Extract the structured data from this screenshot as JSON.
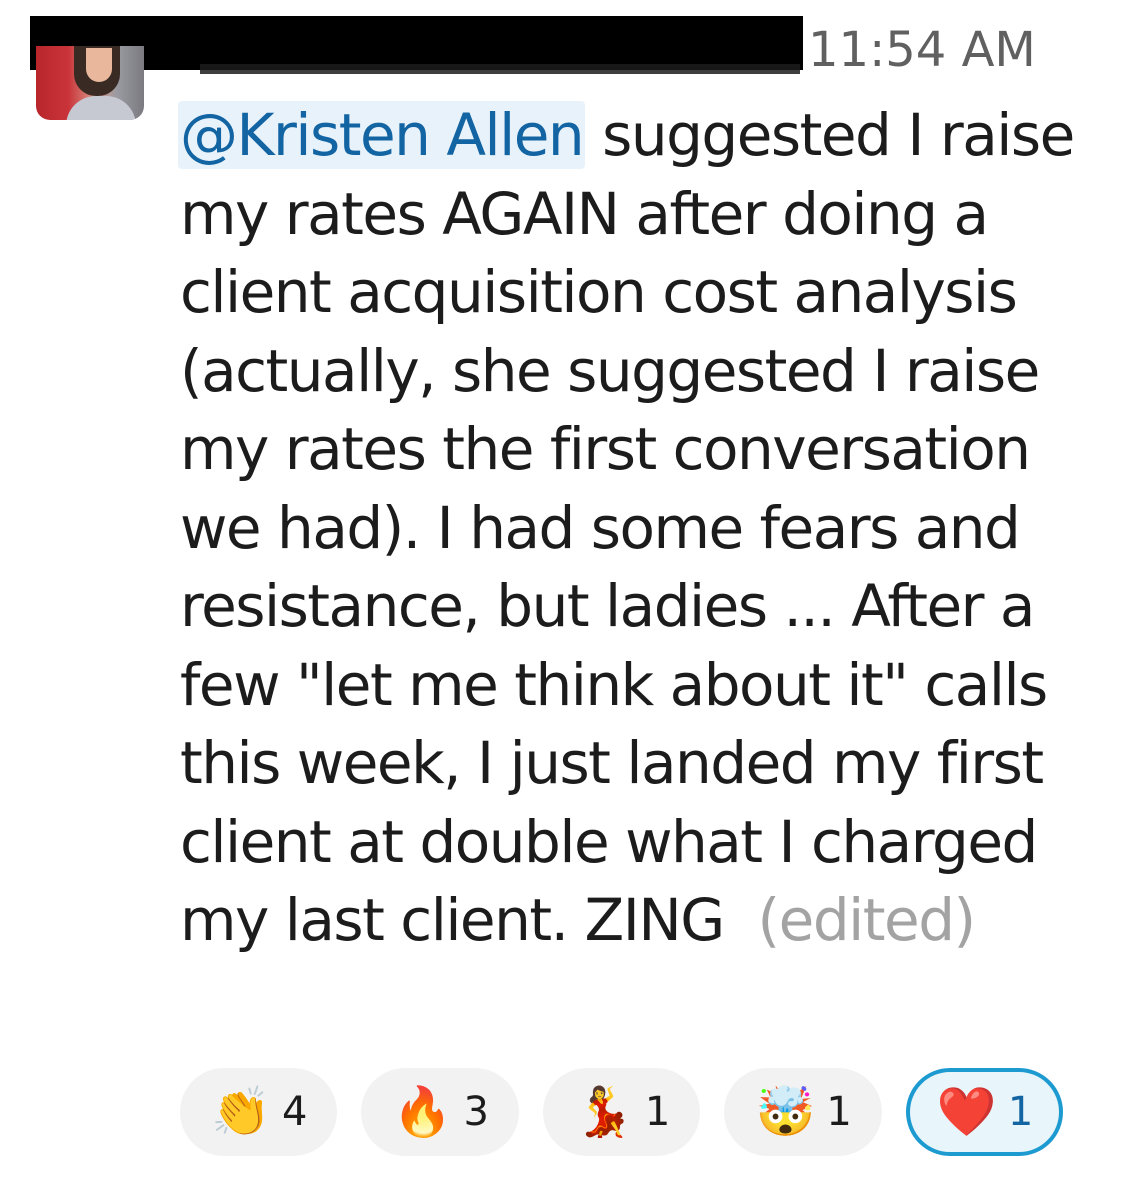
{
  "message": {
    "author_redacted": true,
    "timestamp": "11:54 AM",
    "mention": "@Kristen Allen",
    "body": " suggested I raise my rates AGAIN after doing a client acquisition cost analysis (actually, she suggested I raise my rates the first conversation we had).  I had some fears and resistance, but ladies ... After a few \"let me think about it\" calls this week, I just landed my first client at double what I charged my last client. ZING",
    "edited_label": "(edited)"
  },
  "reactions": [
    {
      "icon": "clapping-hands-icon",
      "glyph": "👏",
      "count": "4",
      "selected": false
    },
    {
      "icon": "fire-icon",
      "glyph": "🔥",
      "count": "3",
      "selected": false
    },
    {
      "icon": "dancer-icon",
      "glyph": "💃",
      "count": "1",
      "selected": false
    },
    {
      "icon": "mind-blown-icon",
      "glyph": "🤯",
      "count": "1",
      "selected": false
    },
    {
      "icon": "red-heart-icon",
      "glyph": "❤️",
      "count": "1",
      "selected": true
    }
  ],
  "colors": {
    "mention_text": "#1264a3",
    "mention_bg": "#e8f2fa",
    "selected_reaction_border": "#1d9bd1",
    "timestamp": "#616061",
    "edited": "#a3a3a3"
  }
}
